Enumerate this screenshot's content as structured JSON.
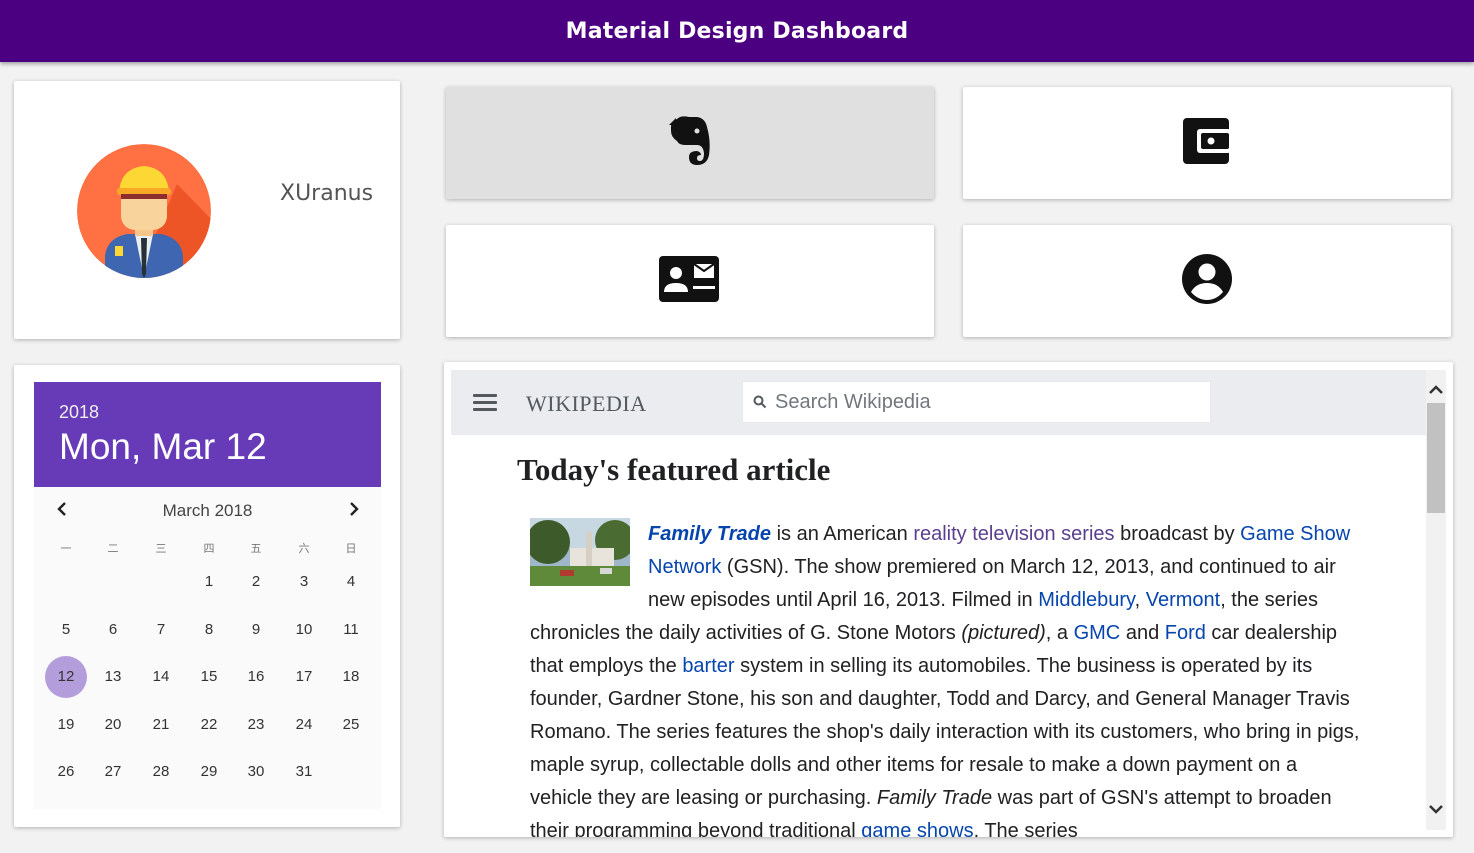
{
  "appbar": {
    "title": "Material Design Dashboard"
  },
  "profile": {
    "username": "XUranus",
    "avatar_icon": "worker-avatar-icon"
  },
  "tiles": [
    {
      "icon": "evernote-icon",
      "active": true
    },
    {
      "icon": "wallet-icon",
      "active": false
    },
    {
      "icon": "contact-mail-icon",
      "active": false
    },
    {
      "icon": "account-circle-icon",
      "active": false
    }
  ],
  "calendar": {
    "year": "2018",
    "selected_date": "Mon, Mar 12",
    "month_label": "March 2018",
    "weekdays": [
      "一",
      "二",
      "三",
      "四",
      "五",
      "六",
      "日"
    ],
    "weeks": [
      [
        "",
        "",
        "",
        "1",
        "2",
        "3",
        "4"
      ],
      [
        "5",
        "6",
        "7",
        "8",
        "9",
        "10",
        "11"
      ],
      [
        "12",
        "13",
        "14",
        "15",
        "16",
        "17",
        "18"
      ],
      [
        "19",
        "20",
        "21",
        "22",
        "23",
        "24",
        "25"
      ],
      [
        "26",
        "27",
        "28",
        "29",
        "30",
        "31",
        ""
      ]
    ],
    "selected_day": "12",
    "header_color": "#673ab7",
    "selected_color": "#b39ddb"
  },
  "wiki": {
    "logo": "WIKIPEDIA",
    "search_placeholder": "Search Wikipedia",
    "heading": "Today's featured article",
    "t1": "Family Trade",
    "t2": " is an American ",
    "t3": "reality television series",
    "t4": " broadcast by ",
    "t5": "Game Show Network",
    "t6": " (GSN). The show premiered on March 12, 2013, and continued to air new episodes until April 16, 2013. Filmed in ",
    "t7": "Middlebury",
    "t8": ", ",
    "t9": "Vermont",
    "t10": ", the series chronicles the daily activities of G. Stone Motors ",
    "t11": "(pictured)",
    "t12": ", a ",
    "t13": "GMC",
    "t14": " and ",
    "t15": "Ford",
    "t16": " car dealership that employs the ",
    "t17": "barter",
    "t18": " system in selling its automobiles. The business is operated by its founder, Gardner Stone, his son and daughter, Todd and Darcy, and General Manager Travis Romano. The series features the shop's daily interaction with its customers, who bring in pigs, maple syrup, collectable dolls and other items for resale to make a down payment on a vehicle they are leasing or purchasing. ",
    "t19": "Family Trade",
    "t20": " was part of GSN's attempt to broaden their programming beyond traditional ",
    "t21": "game shows",
    "t22": ". The series"
  }
}
